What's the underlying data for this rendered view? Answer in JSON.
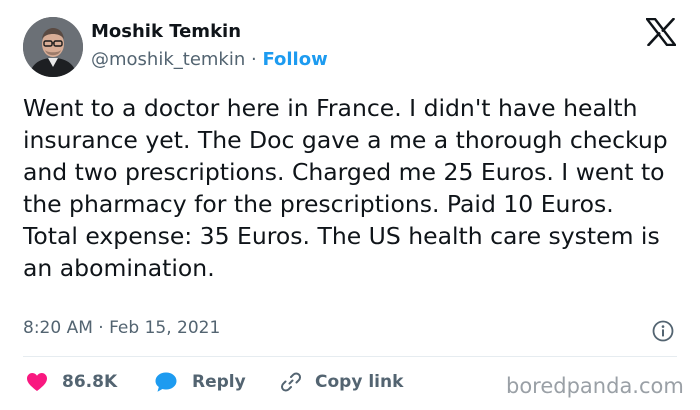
{
  "author": {
    "name": "Moshik Temkin",
    "handle": "@moshik_temkin",
    "separator": " · ",
    "follow_label": "Follow"
  },
  "tweet": {
    "text": "Went to a doctor here in France. I didn't have health insurance yet. The Doc gave a me a thorough checkup and two prescriptions. Charged me 25 Euros. I went to the pharmacy for the prescriptions. Paid 10 Euros. Total expense: 35 Euros. The US health care system is an abomination.",
    "timestamp": "8:20 AM · Feb 15, 2021"
  },
  "actions": {
    "likes_count": "86.8K",
    "reply_label": "Reply",
    "copy_link_label": "Copy link"
  },
  "watermark": "boredpanda.com",
  "colors": {
    "like": "#f91880",
    "reply": "#1d9bf0",
    "follow": "#1d9bf0",
    "secondary_text": "#536471",
    "primary_text": "#0f1419"
  },
  "icons": {
    "logo": "x-logo-icon",
    "info": "info-icon",
    "like": "heart-icon",
    "reply": "speech-bubble-icon",
    "copy": "link-icon"
  }
}
